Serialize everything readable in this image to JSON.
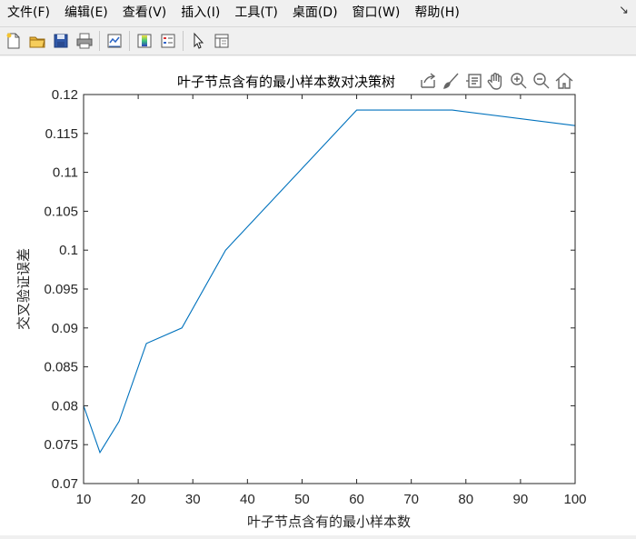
{
  "menu": {
    "items": [
      {
        "label": "文件(F)"
      },
      {
        "label": "编辑(E)"
      },
      {
        "label": "查看(V)"
      },
      {
        "label": "插入(I)"
      },
      {
        "label": "工具(T)"
      },
      {
        "label": "桌面(D)"
      },
      {
        "label": "窗口(W)"
      },
      {
        "label": "帮助(H)"
      }
    ],
    "corner_glyph": "↘"
  },
  "toolbar": {
    "icons": [
      "new-file-icon",
      "open-folder-icon",
      "save-icon",
      "print-icon",
      "link-plot-icon",
      "colorbar-icon",
      "legend-icon",
      "pointer-icon",
      "property-inspector-icon"
    ]
  },
  "axes_toolbar": {
    "icons": [
      "export-icon",
      "brush-icon",
      "data-tips-icon",
      "pan-icon",
      "zoom-in-icon",
      "zoom-out-icon",
      "home-icon"
    ]
  },
  "colors": {
    "line": "#0072BD",
    "axis": "#262626",
    "grid_tick": "#262626"
  },
  "chart_data": {
    "type": "line",
    "title": "叶子节点含有的最小样本数对决策树",
    "xlabel": "叶子节点含有的最小样本数",
    "ylabel": "交叉验证误差",
    "xlim": [
      10,
      100
    ],
    "ylim": [
      0.07,
      0.12
    ],
    "xticks": [
      10,
      20,
      30,
      40,
      50,
      60,
      70,
      80,
      90,
      100
    ],
    "yticks": [
      0.07,
      0.075,
      0.08,
      0.085,
      0.09,
      0.095,
      0.1,
      0.105,
      0.11,
      0.115,
      0.12
    ],
    "xtick_labels": [
      "10",
      "20",
      "30",
      "40",
      "50",
      "60",
      "70",
      "80",
      "90",
      "100"
    ],
    "ytick_labels": [
      "0.07",
      "0.075",
      "0.08",
      "0.085",
      "0.09",
      "0.095",
      "0.1",
      "0.105",
      "0.11",
      "0.115",
      "0.12"
    ],
    "grid": false,
    "series": [
      {
        "x": [
          10,
          13,
          16.5,
          21.5,
          28,
          36,
          60,
          77.5,
          100
        ],
        "y": [
          0.08,
          0.074,
          0.078,
          0.088,
          0.09,
          0.1,
          0.118,
          0.118,
          0.116
        ]
      }
    ]
  }
}
